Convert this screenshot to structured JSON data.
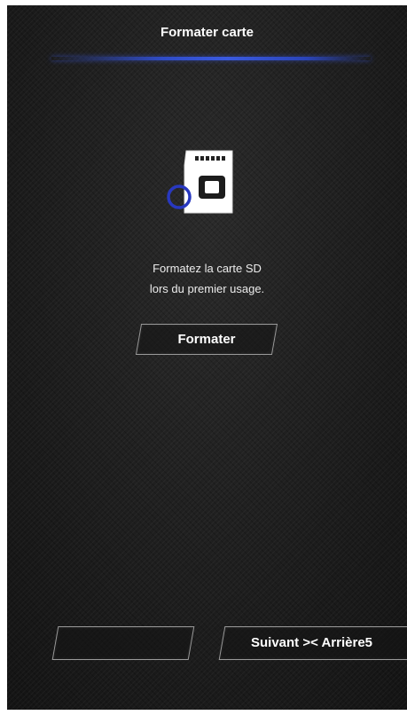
{
  "header": {
    "title": "Formater carte"
  },
  "icon": {
    "name": "sd-card-icon",
    "card_color": "#ffffff",
    "ring_color": "#2838c0"
  },
  "message": {
    "line1": "Formatez la carte SD",
    "line2": "lors du premier usage."
  },
  "actions": {
    "format_label": "Formater",
    "left_label": "",
    "right_label": "Suivant >< Arrière5"
  },
  "colors": {
    "accent": "#2f4cc8",
    "background": "#1f1f1f",
    "button_border": "#9a9a9a"
  }
}
